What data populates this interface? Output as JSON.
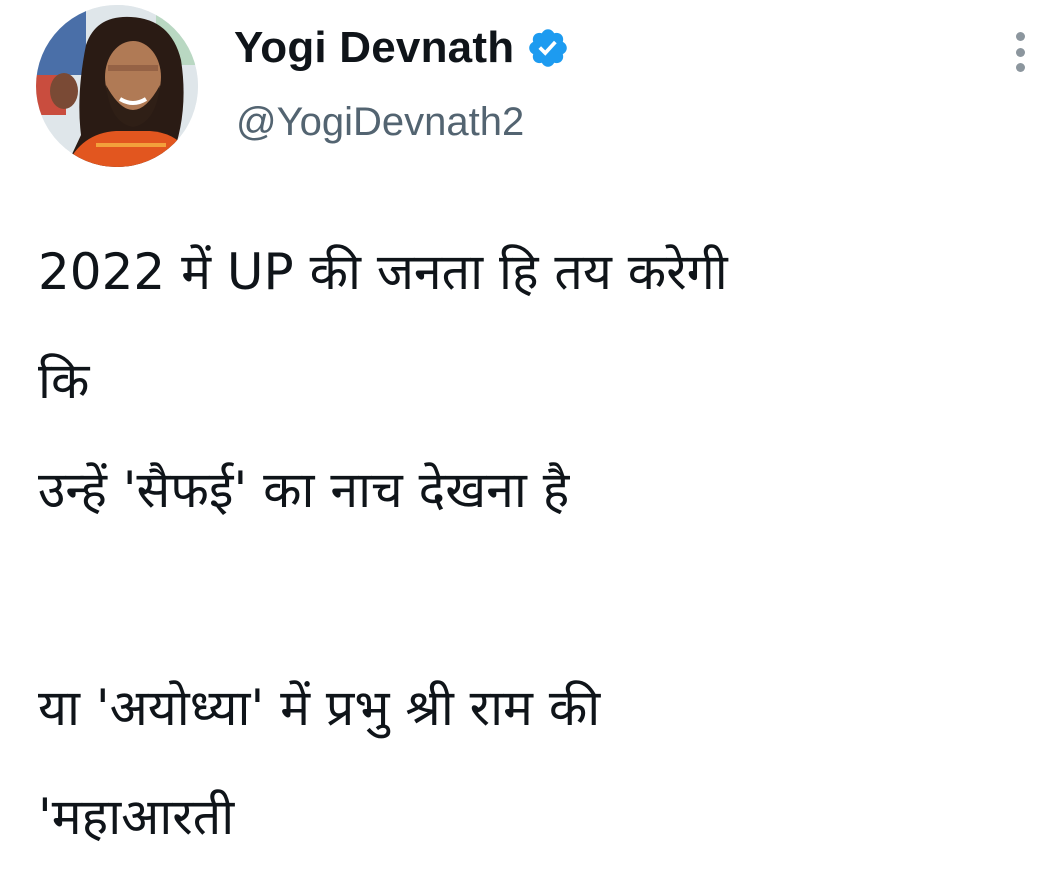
{
  "author": {
    "display_name": "Yogi Devnath",
    "handle": "@YogiDevnath2",
    "verified": true,
    "avatar_icon": "profile-photo-avatar"
  },
  "tweet": {
    "lines": [
      "2022 में UP की जनता हि तय करेगी",
      "कि",
      "उन्हें 'सैफई' का नाच देखना है",
      "",
      "या 'अयोध्या' में प्रभु श्री राम की",
      "'महाआरती"
    ]
  },
  "icons": {
    "verified": "verified-badge-icon",
    "more": "more-options-icon"
  },
  "colors": {
    "verified_blue": "#1d9bf0",
    "text_primary": "#0f1419",
    "text_secondary": "#536471",
    "icon_gray": "#8c969e"
  }
}
